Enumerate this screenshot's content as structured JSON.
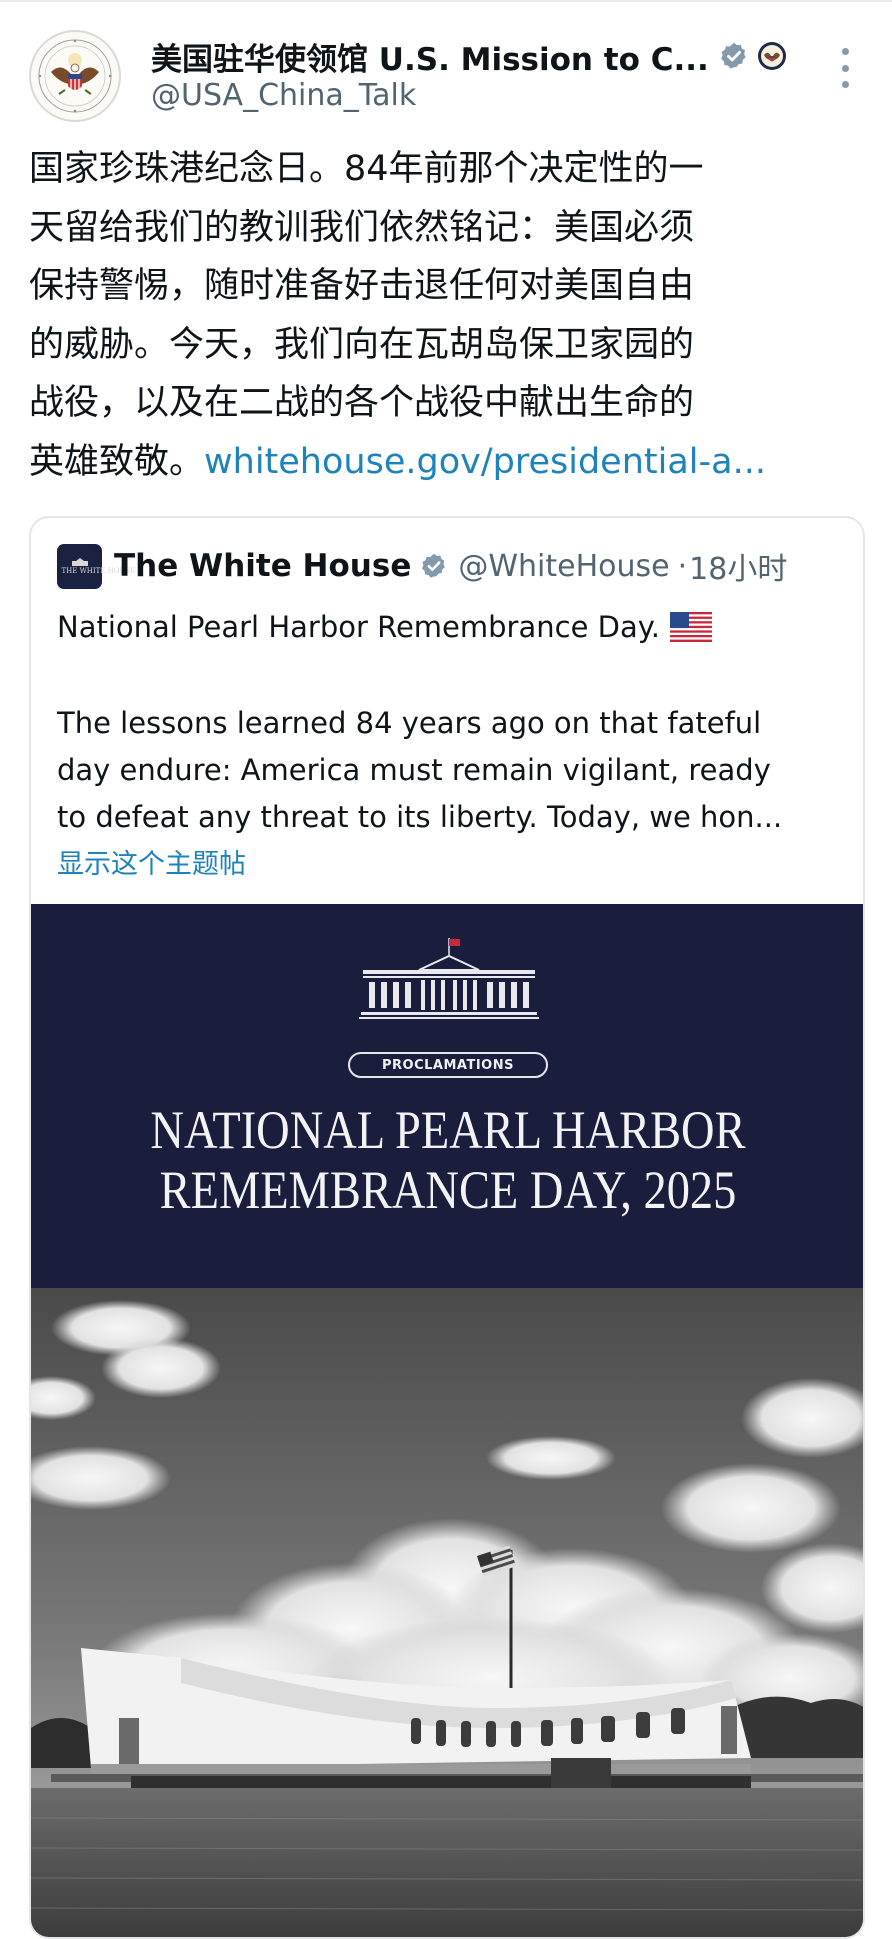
{
  "author": {
    "name": "美国驻华使领馆 U.S. Mission to C...",
    "handle": "@USA_China_Talk",
    "verified_icon": "verified-badge-icon",
    "affiliation_icon": "us-government-seal-icon"
  },
  "tweet": {
    "lines": [
      "国家珍珠港纪念日。84年前那个决定性的一",
      "天留给我们的教训我们依然铭记：美国必须",
      "保持警惕，随时准备好击退任何对美国自由",
      "的威胁。今天，我们向在瓦胡岛保卫家园的",
      "战役，以及在二战的各个战役中献出生命的"
    ],
    "last_line_text": "英雄致敬。",
    "link": "whitehouse.gov/presidential-a..."
  },
  "quote": {
    "name": "The White House",
    "handle": "@WhiteHouse",
    "separator": "·",
    "time": "18小时",
    "avatar_text": "THE WHITE HOUSE",
    "title": "National Pearl Harbor Remembrance Day.",
    "body_lines": [
      "The lessons learned 84 years ago on that fateful",
      "day endure: America must remain vigilant, ready",
      "to defeat any threat to its liberty. Today, we hon..."
    ],
    "show_more": "显示这个主题帖"
  },
  "image": {
    "badge": "PROCLAMATIONS",
    "title_lines": [
      "NATIONAL PEARL HARBOR",
      "REMEMBRANCE DAY, 2025"
    ],
    "banner_color": "#1b1d3c"
  },
  "colors": {
    "link": "#1e83b8",
    "muted": "#536471",
    "verified": "#829aab"
  }
}
